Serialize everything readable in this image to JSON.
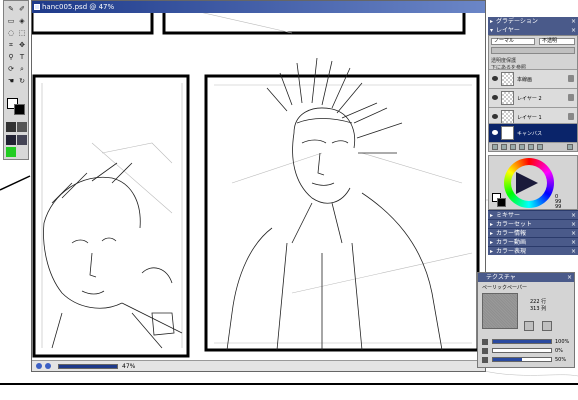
{
  "document": {
    "title": "hanc005.psd @ 47%",
    "zoom_label": "47%"
  },
  "toolbox": {
    "tools": [
      "brush",
      "pencil",
      "eraser",
      "fill",
      "selection",
      "lasso",
      "crop",
      "move",
      "eyedropper",
      "text",
      "transform",
      "zoom"
    ]
  },
  "panels": {
    "gradation": {
      "title": "グラデーション"
    },
    "layers": {
      "title": "レイヤー",
      "mode": "ノーマル",
      "opacity_label": "不透明",
      "options": [
        "透明度保護",
        "下にあるを参照"
      ],
      "items": [
        {
          "name": "本線画",
          "selected": false
        },
        {
          "name": "レイヤー 2",
          "selected": false
        },
        {
          "name": "レイヤー 1",
          "selected": false
        },
        {
          "name": "キャンバス",
          "selected": true
        }
      ]
    },
    "color": {
      "values": [
        "0",
        "99",
        "99"
      ]
    },
    "collapsed": [
      {
        "title": "ミキサー"
      },
      {
        "title": "カラーセット"
      },
      {
        "title": "カラー情報"
      },
      {
        "title": "カラー動画"
      },
      {
        "title": "カラー表現"
      }
    ],
    "texture": {
      "title": "テクスチャ",
      "name": "ペーリックペーパー",
      "size_line1": "222 行",
      "size_line2": "313 列",
      "sliders": [
        {
          "label": "100%",
          "value": 1.0
        },
        {
          "label": "0%",
          "value": 0.0
        },
        {
          "label": "50%",
          "value": 0.5
        }
      ]
    }
  }
}
